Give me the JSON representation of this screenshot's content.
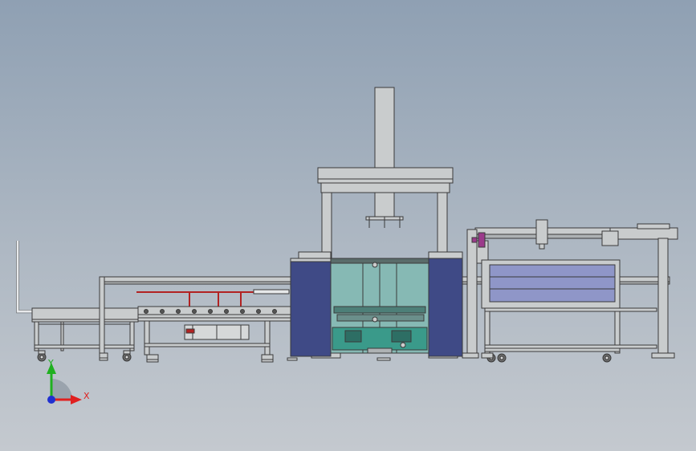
{
  "viewport": {
    "background_top": "#8fa0b3",
    "background_bottom": "#c4c9cf"
  },
  "triad": {
    "x_label": "X",
    "y_label": "Y",
    "x_color": "#e02020",
    "y_color": "#20b020",
    "z_color": "#2030d0"
  },
  "colors": {
    "frame_fill": "#c9cccd",
    "frame_stroke": "#3a3a3a",
    "panel_blue": "#3f4a86",
    "panel_light_blue": "#8f96c8",
    "machine_teal": "#3a9a8a",
    "glass": "#86b9b4",
    "rod_red": "#b22222",
    "accent_purple": "#9b3b8b"
  }
}
